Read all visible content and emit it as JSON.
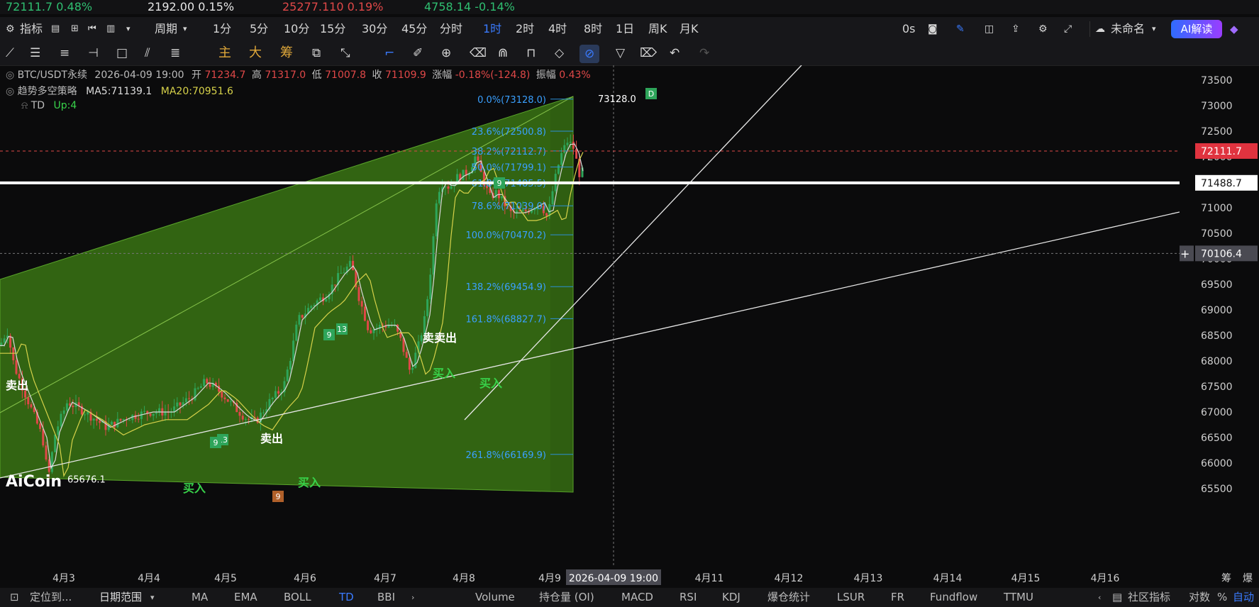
{
  "ticker": [
    {
      "text": "72111.7  0.48%",
      "color": "#2fbf71"
    },
    {
      "text": "2192.00  0.15%",
      "color": "#e8e8e8"
    },
    {
      "text": "25277.110  0.19%",
      "color": "#e04848"
    },
    {
      "text": "4758.14  -0.14%",
      "color": "#2fbf71"
    }
  ],
  "toolbar": {
    "indicator": "指标",
    "period": "周期",
    "intervals": [
      "1分",
      "5分",
      "10分",
      "15分",
      "30分",
      "45分",
      "分时",
      "1时",
      "2时",
      "4时",
      "8时",
      "1日",
      "周K",
      "月K"
    ],
    "active_interval": "1时",
    "zero_s": "0s",
    "layout_name": "未命名",
    "ai_button": "AI解读"
  },
  "drawbar": {
    "zhu": "主",
    "da": "大",
    "chou": "筹"
  },
  "info": {
    "symbol": "BTC/USDT永续",
    "datetime": "2026-04-09 19:00",
    "open_label": "开",
    "open": "71234.7",
    "high_label": "高",
    "high": "71317.0",
    "low_label": "低",
    "low": "71007.8",
    "close_label": "收",
    "close": "71109.9",
    "change_label": "涨幅",
    "change": "-0.18%(-124.8)",
    "amp_label": "振幅",
    "amp": "0.43%",
    "strategy": "趋势多空策略",
    "ma5": "MA5:71139.1",
    "ma20": "MA20:70951.6",
    "td": "TD",
    "td_up": "Up:4"
  },
  "chart_data": {
    "type": "candlestick",
    "symbol": "BTC/USDT永续",
    "interval": "1时",
    "y_ticks": [
      65500,
      66000,
      66500,
      67000,
      67500,
      68000,
      68500,
      69000,
      69500,
      70000,
      70500,
      71000,
      71500,
      72000,
      72500,
      73000,
      73500
    ],
    "ylim": [
      65250,
      73850
    ],
    "x_ticks": [
      "4月3",
      "4月4",
      "4月5",
      "4月6",
      "4月7",
      "4月8",
      "4月9",
      "4月11",
      "4月12",
      "4月13",
      "4月14",
      "4月15",
      "4月16"
    ],
    "crosshair_date": "2026-04-09 19:00",
    "current_price": "72111.7",
    "line_price": "71488.7",
    "crosshair_price": "70106.4",
    "high_mark": "73128.0",
    "low_mark": "65676.1",
    "fib_levels": [
      {
        "label": "0.0%(73128.0)",
        "price": 73128.0
      },
      {
        "label": "23.6%(72500.8)",
        "price": 72500.8
      },
      {
        "label": "38.2%(72112.7)",
        "price": 72112.7
      },
      {
        "label": "50.0%(71799.1)",
        "price": 71799.1
      },
      {
        "label": "61.8%(71485.5)",
        "price": 71485.5
      },
      {
        "label": "78.6%(71039.0)",
        "price": 71039.0
      },
      {
        "label": "100.0%(70470.2)",
        "price": 70470.2
      },
      {
        "label": "138.2%(69454.9)",
        "price": 69454.9
      },
      {
        "label": "161.8%(68827.7)",
        "price": 68827.7
      },
      {
        "label": "261.8%(66169.9)",
        "price": 66169.9
      }
    ],
    "signals": [
      {
        "text": "卖出",
        "color": "#ffffff"
      },
      {
        "text": "买入",
        "color": "#38d24a"
      },
      {
        "text": "卖出",
        "color": "#ffffff"
      },
      {
        "text": "买入",
        "color": "#38d24a"
      },
      {
        "text": "卖卖出",
        "color": "#ffffff"
      },
      {
        "text": "买入",
        "color": "#38d24a"
      },
      {
        "text": "买入",
        "color": "#38d24a"
      }
    ],
    "td_counts": [
      "13",
      "9",
      "9",
      "13",
      "9",
      "9",
      "D"
    ],
    "colors": {
      "up": "#2ea55a",
      "down": "#e04848",
      "ma5": "#d8d8d8",
      "ma20": "#d7d24a",
      "channel": "#5aa52b"
    }
  },
  "watermark": "AiCoin",
  "bottom": {
    "locate": "定位到...",
    "date_range": "日期范围",
    "indicators": [
      "MA",
      "EMA",
      "BOLL",
      "TD",
      "BBI"
    ],
    "active_indicator": "TD",
    "sub_indicators": [
      "Volume",
      "持仓量 (OI)",
      "MACD",
      "RSI",
      "KDJ",
      "爆仓统计",
      "LSUR",
      "FR",
      "Fundflow",
      "TTMU"
    ],
    "community": "社区指标",
    "log": "对数",
    "percent": "%",
    "auto": "自动"
  },
  "axis_corner": {
    "a": "筹",
    "b": "爆"
  }
}
